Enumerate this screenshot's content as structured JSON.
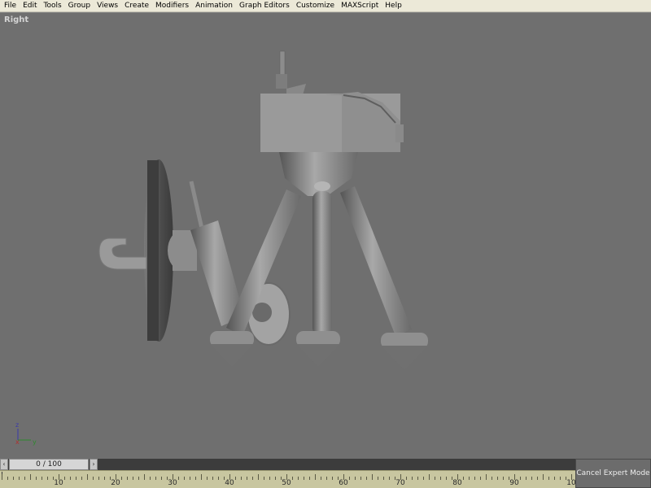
{
  "menu": [
    "File",
    "Edit",
    "Tools",
    "Group",
    "Views",
    "Create",
    "Modifiers",
    "Animation",
    "Graph Editors",
    "Customize",
    "MAXScript",
    "Help"
  ],
  "viewport": {
    "label": "Right"
  },
  "axis_gizmo": {
    "z": "z",
    "x": "x",
    "y": "y"
  },
  "time_slider": {
    "value": "0 / 100",
    "prev_icon": "chevron-left-icon",
    "next_icon": "chevron-right-icon"
  },
  "trackbar": {
    "ticks": [
      "10",
      "20",
      "30",
      "40",
      "50",
      "60",
      "70",
      "80",
      "90",
      "10"
    ]
  },
  "expert_button": {
    "label": "Cancel Expert Mode"
  },
  "colors": {
    "viewport_bg": "#6f6f6f",
    "model": "#9a9a9a",
    "trackbar": "#c8c6a0",
    "menubar": "#ece9d8"
  }
}
